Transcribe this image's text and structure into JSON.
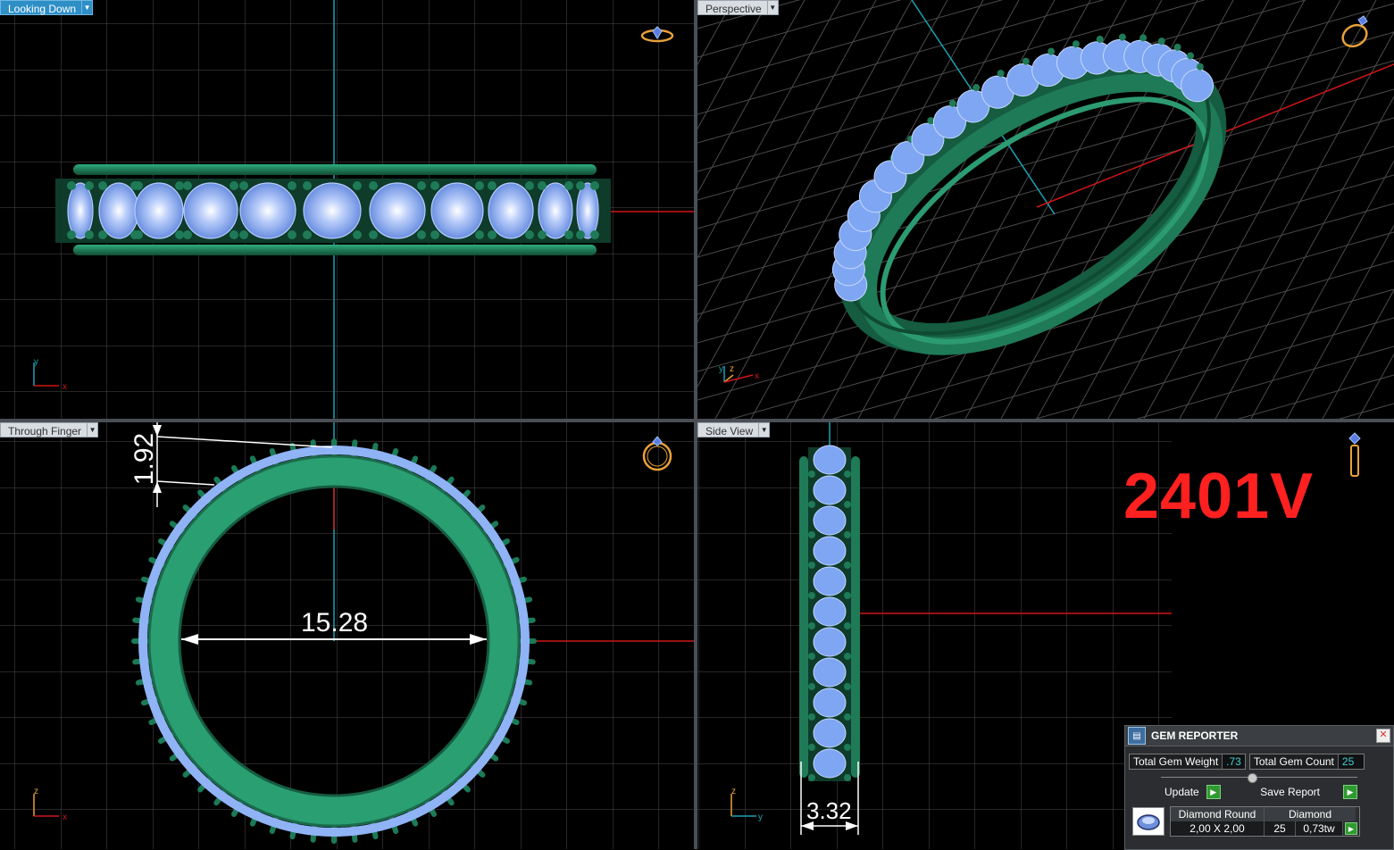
{
  "viewports": {
    "top_left": {
      "label": "Looking Down"
    },
    "top_right": {
      "label": "Perspective"
    },
    "bottom_left": {
      "label": "Through Finger"
    },
    "bottom_right": {
      "label": "Side View"
    }
  },
  "dimensions": {
    "band_height": "1.92",
    "inner_diameter": "15.28",
    "band_width": "3.32"
  },
  "watermark": "2401V",
  "axes": {
    "top_left": {
      "a": "y",
      "b": "x"
    },
    "top_right": {
      "a": "y",
      "b": "z",
      "c": "x"
    },
    "bottom_left": {
      "a": "z",
      "b": "x"
    },
    "bottom_right": {
      "a": "z",
      "b": "y"
    }
  },
  "gem_reporter": {
    "title": "GEM REPORTER",
    "total_gem_weight_label": "Total Gem Weight",
    "total_gem_weight_value": ".73",
    "total_gem_count_label": "Total Gem Count",
    "total_gem_count_value": "25",
    "update_label": "Update",
    "save_report_label": "Save Report",
    "table": {
      "col1_header": "Diamond Round",
      "col2_header": "Diamond",
      "size": "2,00 X 2,00",
      "count": "25",
      "weight": "0,73tw"
    }
  },
  "colors": {
    "metal": "#1f7a57",
    "metal_light": "#2fae7e",
    "gem": "#8fb3f5",
    "grid": "#4b4b4b",
    "axis_red": "#d01616",
    "axis_cyan": "#1ea0b4",
    "watermark": "#ff2020"
  }
}
